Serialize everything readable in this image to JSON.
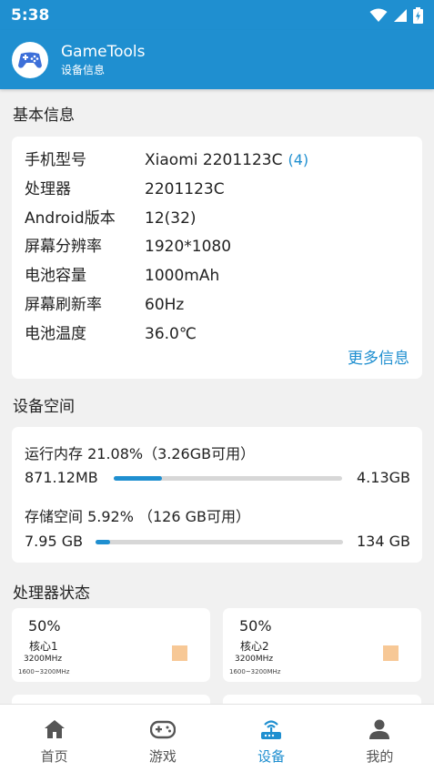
{
  "status_bar": {
    "time": "5:38"
  },
  "app_bar": {
    "title": "GameTools",
    "subtitle": "设备信息"
  },
  "basic_info": {
    "title": "基本信息",
    "rows": [
      {
        "label": "手机型号",
        "value": "Xiaomi 2201123C",
        "extra": "(4)"
      },
      {
        "label": "处理器",
        "value": "2201123C"
      },
      {
        "label": "Android版本",
        "value": "12(32)"
      },
      {
        "label": "屏幕分辨率",
        "value": "1920*1080"
      },
      {
        "label": "电池容量",
        "value": "1000mAh"
      },
      {
        "label": "屏幕刷新率",
        "value": "60Hz"
      },
      {
        "label": "电池温度",
        "value": "36.0℃"
      }
    ],
    "more_link": "更多信息"
  },
  "device_space": {
    "title": "设备空间",
    "ram": {
      "label": "运行内存 21.08%（3.26GB可用）",
      "used": "871.12MB",
      "total": "4.13GB",
      "fraction": 0.2108
    },
    "storage": {
      "label": "存储空间 5.92% （126 GB可用）",
      "used": "7.95 GB",
      "total": "134 GB",
      "fraction": 0.0592
    }
  },
  "cpu_status": {
    "title": "处理器状态",
    "cores": [
      {
        "percent": "50%",
        "name": "核心1",
        "freq": "3200MHz",
        "range": "1600~3200MHz"
      },
      {
        "percent": "50%",
        "name": "核心2",
        "freq": "3200MHz",
        "range": "1600~3200MHz"
      }
    ],
    "indicator_color": "#f7c896"
  },
  "bottom_nav": {
    "items": [
      {
        "label": "首页",
        "icon": "home-icon"
      },
      {
        "label": "游戏",
        "icon": "gamepad-icon"
      },
      {
        "label": "设备",
        "icon": "router-icon",
        "active": true
      },
      {
        "label": "我的",
        "icon": "person-icon"
      }
    ]
  },
  "colors": {
    "accent": "#1f8fd0",
    "background": "#f1f1f1",
    "track": "#d7d7d7"
  }
}
